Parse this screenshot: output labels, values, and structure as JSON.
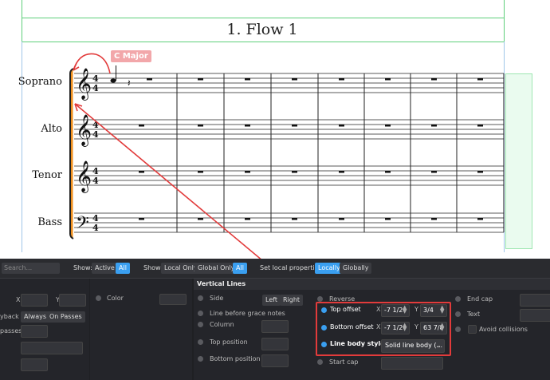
{
  "score": {
    "flow_title": "1. Flow 1",
    "key_signpost": "C Major",
    "instruments": [
      "Soprano",
      "Alto",
      "Tenor",
      "Bass"
    ]
  },
  "toolbar": {
    "search_placeholder": "Search...",
    "show1_label": "Show:",
    "show1_options": [
      "Active",
      "All"
    ],
    "show2_label": "Show:",
    "show2_options": [
      "Local Only",
      "Global Only",
      "All"
    ],
    "set_local_label": "Set local properties:",
    "set_local_options": [
      "Locally",
      "Globally"
    ]
  },
  "left_panel": {
    "x_label": "X",
    "y_label": "Y",
    "playback_label": "yback",
    "playback_options": [
      "Always",
      "On Passes"
    ],
    "passes_label": "passes",
    "color_label": "Color"
  },
  "vertical_lines": {
    "title": "Vertical Lines",
    "side_label": "Side",
    "side_options": [
      "Left",
      "Right"
    ],
    "line_before_grace": "Line before grace notes",
    "column_label": "Column",
    "top_position": "Top position",
    "bottom_position": "Bottom position",
    "reverse_label": "Reverse",
    "top_offset": {
      "label": "Top offset",
      "x_label": "X",
      "x": "-7 1/2",
      "y_label": "Y",
      "y": "3/4"
    },
    "bottom_offset": {
      "label": "Bottom offset",
      "x_label": "X",
      "x": "-7 1/2",
      "y_label": "Y",
      "y": "63 7/8"
    },
    "line_body_style": {
      "label": "Line body style",
      "value": "Solid line body (..."
    },
    "start_cap": "Start cap",
    "end_cap": "End cap",
    "text_label": "Text",
    "avoid_collisions": "Avoid collisions"
  },
  "colors": {
    "accent": "#3a9ff0",
    "highlight": "#e23b3b",
    "frame": "#5ecf7a"
  }
}
